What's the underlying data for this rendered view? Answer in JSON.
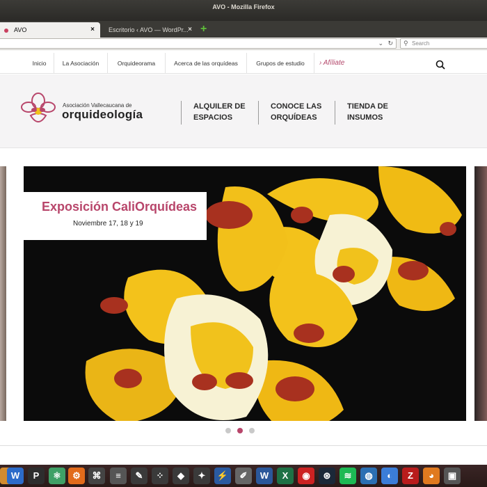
{
  "window": {
    "title": "AVO - Mozilla Firefox"
  },
  "tabs": [
    {
      "label": "AVO",
      "close": "×"
    },
    {
      "label": "Escritorio ‹ AVO — WordPr...",
      "close": "×"
    }
  ],
  "newtab": {
    "glyph": "+"
  },
  "urlbar": {
    "dropdown_glyph": "⌄",
    "reload_glyph": "↻",
    "search_placeholder": "Search"
  },
  "sitenav": {
    "items": [
      "Inicio",
      "La Asociación",
      "Orquideorama",
      "Acerca de las orquídeas",
      "Grupos de estudio"
    ],
    "affiliate": "› Afíliate"
  },
  "header": {
    "assoc_line": "Asociación Vallecaucana de",
    "brand": "orquideología",
    "nav": [
      {
        "line1": "ALQUILER DE",
        "line2": "ESPACIOS"
      },
      {
        "line1": "CONOCE LAS",
        "line2": "ORQUÍDEAS"
      },
      {
        "line1": "TIENDA DE",
        "line2": "INSUMOS"
      }
    ]
  },
  "slider": {
    "title": "Exposición CaliOrquídeas",
    "subtitle": "Noviembre 17, 18 y 19",
    "active_index": 1,
    "count": 3
  },
  "taskbar": {
    "icons": [
      "P",
      "W",
      "X",
      "F",
      "Z"
    ]
  },
  "colors": {
    "accent": "#b8466b",
    "orchid_yellow": "#f3c21b",
    "orchid_spot": "#a8311f"
  }
}
